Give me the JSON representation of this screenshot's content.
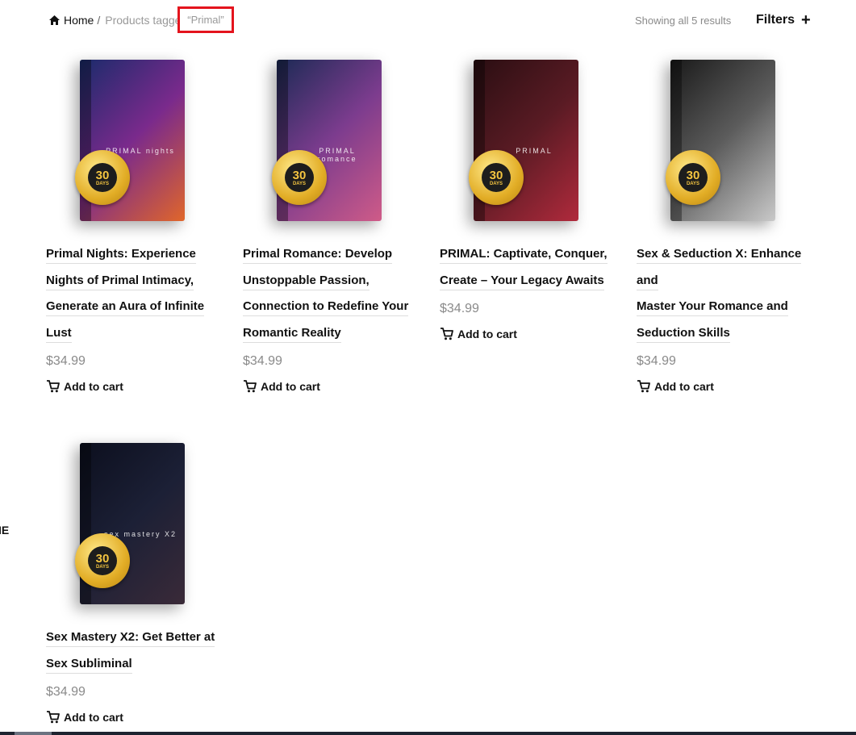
{
  "breadcrumb": {
    "home_label": "Home",
    "separator": "/",
    "current_prefix": "Products tagge",
    "current_tag": "“Primal”"
  },
  "results_text": "Showing all 5 results",
  "filters_label": "Filters",
  "left_edge_text": "IE",
  "colors": {
    "highlight": "#e4141d",
    "muted_text": "#8a8a8a",
    "dark_text": "#111111"
  },
  "products": [
    {
      "title_lines": [
        "Primal Nights: Experience",
        "Nights of Primal Intimacy,",
        "Generate an Aura of Infinite",
        "Lust"
      ],
      "price": "$34.99",
      "cart_label": "Add to cart",
      "box_text": "PRIMAL nights",
      "box_colors": [
        "#1a2b6b",
        "#7a2a8c",
        "#e0662a"
      ],
      "badge_num": "30",
      "badge_days": "DAYS"
    },
    {
      "title_lines": [
        "Primal Romance: Develop",
        "Unstoppable Passion,",
        "Connection to Redefine Your",
        "Romantic Reality"
      ],
      "price": "$34.99",
      "cart_label": "Add to cart",
      "box_text": "PRIMAL romance",
      "box_colors": [
        "#1c2a55",
        "#7c3c8e",
        "#cf5b88"
      ],
      "badge_num": "30",
      "badge_days": "DAYS"
    },
    {
      "title_lines": [
        "PRIMAL: Captivate, Conquer,",
        "Create – Your Legacy Awaits"
      ],
      "price": "$34.99",
      "cart_label": "Add to cart",
      "box_text": "PRIMAL",
      "box_colors": [
        "#2a0e12",
        "#5a1b24",
        "#b02a3c"
      ],
      "badge_num": "30",
      "badge_days": "DAYS"
    },
    {
      "title_lines": [
        "Sex & Seduction X: Enhance and",
        "Master Your Romance and",
        "Seduction Skills"
      ],
      "price": "$34.99",
      "cart_label": "Add to cart",
      "box_text": "",
      "box_colors": [
        "#1a1a1a",
        "#5c5c5c",
        "#c9c9c9"
      ],
      "badge_num": "30",
      "badge_days": "DAYS"
    },
    {
      "title_lines": [
        "Sex Mastery X2: Get Better at",
        "Sex Subliminal"
      ],
      "price": "$34.99",
      "cart_label": "Add to cart",
      "box_text": "sex mastery X2",
      "box_colors": [
        "#0c0f1e",
        "#1c2036",
        "#3a2a38"
      ],
      "badge_num": "30",
      "badge_days": "DAYS"
    }
  ]
}
